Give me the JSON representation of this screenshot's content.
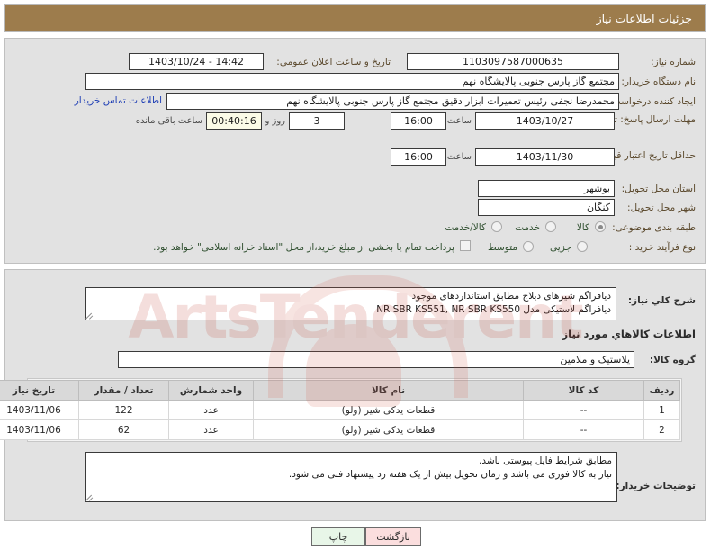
{
  "header": {
    "title": "جزئیات اطلاعات نیاز"
  },
  "form": {
    "need_number_label": "شماره نیاز:",
    "need_number_value": "1103097587000635",
    "announce_datetime_label": "تاریخ و ساعت اعلان عمومی:",
    "announce_datetime_value": "1403/10/24 - 14:42",
    "buyer_org_label": "نام دستگاه خریدار:",
    "buyer_org_value": "مجتمع گاز پارس جنوبی  پالایشگاه نهم",
    "requester_label": "ایجاد کننده درخواست:",
    "requester_value": "محمدرضا نجفی رئیس تعمیرات ابزار دقیق مجتمع گاز پارس جنوبی  پالایشگاه نهم",
    "buyer_contact_link": "اطلاعات تماس خریدار",
    "response_deadline_label": "مهلت ارسال پاسخ: تا تاریخ:",
    "response_deadline_date": "1403/10/27",
    "response_deadline_hour_label": "ساعت",
    "response_deadline_hour": "16:00",
    "remaining_days": "3",
    "remaining_days_label": "روز و",
    "remaining_time": "00:40:16",
    "remaining_time_label": "ساعت باقی مانده",
    "price_validity_label": "حداقل تاریخ اعتبار قیمت: تا تاریخ:",
    "price_validity_date": "1403/11/30",
    "price_validity_hour_label": "ساعت",
    "price_validity_hour": "16:00",
    "province_label": "استان محل تحویل:",
    "province_value": "بوشهر",
    "city_label": "شهر محل تحویل:",
    "city_value": "کنگان",
    "subject_class_label": "طبقه بندی موضوعی:",
    "subject_options": [
      {
        "label": "کالا",
        "selected": true
      },
      {
        "label": "خدمت",
        "selected": false
      },
      {
        "label": "کالا/خدمت",
        "selected": false
      }
    ],
    "process_type_label": "نوع فرآیند خرید :",
    "process_options": [
      {
        "label": "جزیی",
        "selected": false
      },
      {
        "label": "متوسط",
        "selected": false
      }
    ],
    "treasury_checkbox_label": "پرداخت تمام یا بخشی از مبلغ خرید،از محل \"اسناد خزانه اسلامی\" خواهد بود.",
    "treasury_checked": false
  },
  "description": {
    "label": "شرح کلي نیاز:",
    "text": "دیافراگم شیرهای دیلاج مطابق استانداردهای موجود\nدیافراگم لاستیکی مدل NR SBR KS551, NR SBR KS550"
  },
  "goods_section": {
    "heading": "اطلاعات کالاهاي مورد نیاز",
    "group_label": "گروه کالا:",
    "group_value": "پلاستیک و ملامین",
    "columns": [
      "ردیف",
      "کد کالا",
      "نام کالا",
      "واحد شمارش",
      "تعداد / مقدار",
      "تاریخ نیاز"
    ],
    "rows": [
      {
        "index": "1",
        "code": "--",
        "name": "قطعات یدکی شیر (ولو)",
        "unit": "عدد",
        "qty": "122",
        "date": "1403/11/06"
      },
      {
        "index": "2",
        "code": "--",
        "name": "قطعات یدکی شیر (ولو)",
        "unit": "عدد",
        "qty": "62",
        "date": "1403/11/06"
      }
    ]
  },
  "buyer_notes": {
    "label": "توضیحات خریدار:",
    "text": "مطابق شرایط فایل پیوستی باشد.\nنیاز به کالا فوری می باشد و زمان تحویل بیش از یک هفته رد پیشنهاد فنی می شود."
  },
  "buttons": {
    "print": "چاپ",
    "back": "بازگشت"
  },
  "watermark": {
    "text": "ArtsTenderent"
  },
  "colors": {
    "header_bg": "#9d7c4c",
    "panel_bg": "#e2e2e2",
    "link": "#1f3fb5",
    "print_btn": "#e8f6e8",
    "back_btn": "#fbdede",
    "timer_bg": "#fbfbe7"
  }
}
